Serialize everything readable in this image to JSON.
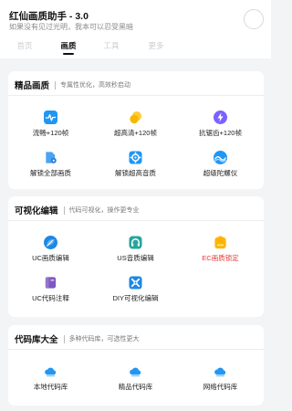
{
  "header": {
    "title": "红仙画质助手 - 3.0",
    "subtitle": "如果没有见过光明，我本可以忍受黑暗"
  },
  "tabs": [
    {
      "label": "首页"
    },
    {
      "label": "画质"
    },
    {
      "label": "工具"
    },
    {
      "label": "更多"
    }
  ],
  "active_tab": "画质",
  "sections": [
    {
      "title": "精品画质",
      "desc": "专属性优化，高效秒启动",
      "items": [
        {
          "label": "流畅+120帧",
          "icon": "pulse-icon"
        },
        {
          "label": "超高清+120帧",
          "icon": "circles-icon"
        },
        {
          "label": "抗锯齿+120帧",
          "icon": "bolt-icon"
        },
        {
          "label": "解锁全部画质",
          "icon": "file-lock-icon"
        },
        {
          "label": "解锁超高音质",
          "icon": "gear-icon"
        },
        {
          "label": "超级陀螺仪",
          "icon": "wave-icon"
        }
      ]
    },
    {
      "title": "可视化编辑",
      "desc": "代码可视化，操作更专业",
      "items": [
        {
          "label": "UC画质编辑",
          "icon": "leaf-icon"
        },
        {
          "label": "US音质编辑",
          "icon": "headphones-icon"
        },
        {
          "label": "EC画质锁定",
          "icon": "battery-icon",
          "color": "#e53935"
        },
        {
          "label": "UC代码注释",
          "icon": "book-icon"
        },
        {
          "label": "DIY可视化编辑",
          "icon": "puzzle-icon"
        }
      ]
    },
    {
      "title": "代码库大全",
      "desc": "多种代码库，可选性更大",
      "items": [
        {
          "label": "本地代码库",
          "icon": "cloud-icon"
        },
        {
          "label": "精品代码库",
          "icon": "cloud-icon"
        },
        {
          "label": "网络代码库",
          "icon": "cloud-icon"
        }
      ]
    }
  ],
  "colors": {
    "blue": "#2196f3",
    "yellow": "#f5b800",
    "purple": "#7b61ff",
    "orange": "#ffb300",
    "red": "#e53935"
  }
}
